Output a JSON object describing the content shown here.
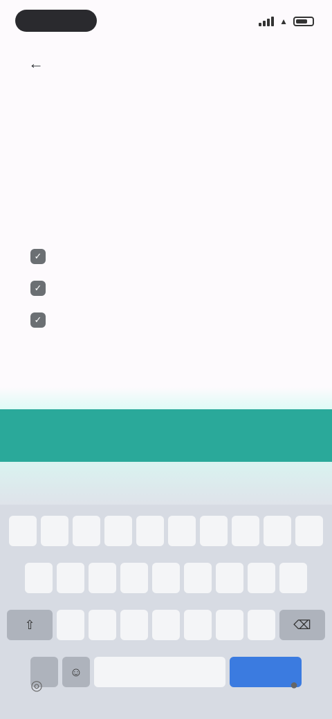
{
  "status": {
    "time": "",
    "icons": [
      "signal-icon",
      "wifi-icon",
      "battery-icon"
    ]
  },
  "header": {
    "back_icon": "arrow-left-icon",
    "title": "",
    "subtitle": ""
  },
  "list": {
    "items": [
      {
        "label": "",
        "icon": "check-icon"
      },
      {
        "label": "",
        "icon": "check-icon"
      },
      {
        "label": "",
        "icon": "check-icon"
      }
    ]
  },
  "footer": {
    "link_text": "",
    "cta_label": ""
  },
  "keyboard": {
    "suggestions": [
      "",
      "",
      ""
    ],
    "rows": [
      [
        "",
        "",
        "",
        "",
        "",
        "",
        "",
        "",
        "",
        ""
      ],
      [
        "",
        "",
        "",
        "",
        "",
        "",
        "",
        "",
        ""
      ],
      [
        "",
        "",
        "",
        "",
        "",
        "",
        ""
      ]
    ],
    "space_label": "",
    "return_label": ""
  },
  "colors": {
    "accent": "#2aa99a",
    "background": "#fdfafd",
    "keyboard_bg": "#d7dbe3",
    "return_key": "#3b7be0"
  }
}
